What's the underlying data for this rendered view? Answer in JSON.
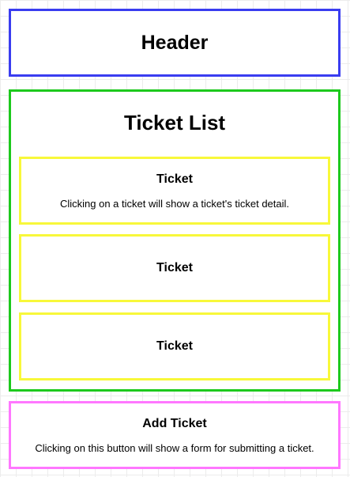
{
  "colors": {
    "header_border": "#3a3df0",
    "ticket_list_border": "#1dc91d",
    "ticket_border": "#f8f83a",
    "add_ticket_border": "#ff77ff"
  },
  "header": {
    "label": "Header"
  },
  "ticket_list": {
    "label": "Ticket List",
    "tickets": [
      {
        "label": "Ticket",
        "description": "Clicking on a ticket will show a ticket's ticket detail."
      },
      {
        "label": "Ticket"
      },
      {
        "label": "Ticket"
      }
    ]
  },
  "add_ticket": {
    "label": "Add Ticket",
    "description": "Clicking on this button will show a form for submitting a ticket."
  }
}
